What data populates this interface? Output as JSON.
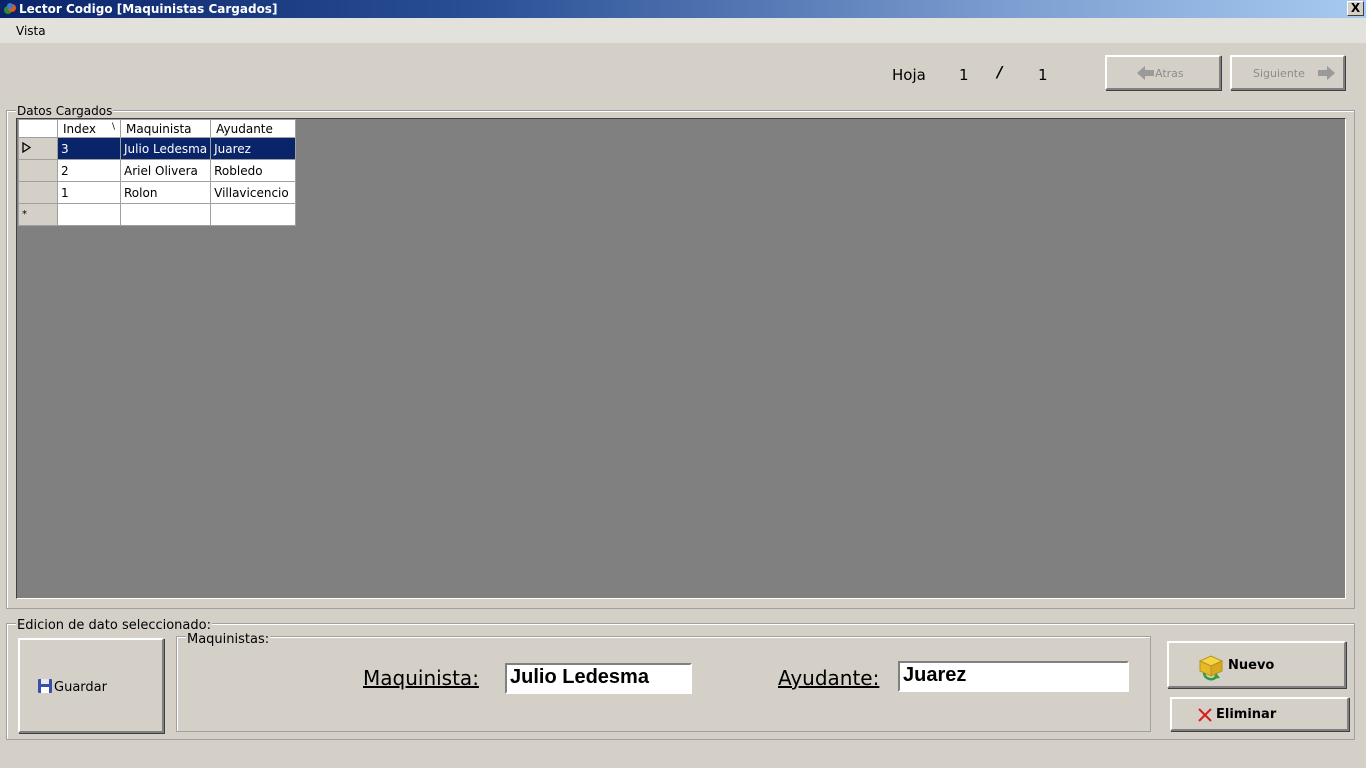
{
  "window": {
    "title": "Lector Codigo [Maquinistas Cargados]",
    "close_label": "X"
  },
  "menu": {
    "items": [
      "Vista"
    ]
  },
  "pager": {
    "hoja_label": "Hoja",
    "current": "1",
    "separator": "/",
    "total": "1"
  },
  "buttons": {
    "atras": "Atras",
    "siguiente": "Siguiente",
    "guardar": "Guardar",
    "nuevo": "Nuevo",
    "eliminar": "Eliminar"
  },
  "datos": {
    "group_label": "Datos Cargados",
    "columns": [
      "Index",
      "Maquinista",
      "Ayudante"
    ],
    "sort_indicator": "\\",
    "rows": [
      {
        "index": "3",
        "maquinista": "Julio Ledesma",
        "ayudante": "Juarez",
        "selected": true
      },
      {
        "index": "2",
        "maquinista": "Ariel Olivera",
        "ayudante": "Robledo",
        "selected": false
      },
      {
        "index": "1",
        "maquinista": "Rolon",
        "ayudante": "Villavicencio",
        "selected": false
      }
    ],
    "new_row_marker": "*"
  },
  "edicion": {
    "group_label": "Edicion de dato seleccionado:",
    "maquinistas_group_label": "Maquinistas:",
    "maquinista_label": "Maquinista:",
    "maquinista_value": "Julio Ledesma",
    "ayudante_label": "Ayudante:",
    "ayudante_value": "Juarez"
  },
  "icons": {
    "app": "app-icon",
    "back": "arrow-left-icon",
    "forward": "arrow-right-icon",
    "save": "floppy-disk-icon",
    "new": "new-box-icon",
    "delete": "red-x-icon"
  },
  "colors": {
    "titlebar": "#0a246a",
    "selection": "#0a246a",
    "grid_background": "#808080",
    "window": "#d4d0c8"
  }
}
